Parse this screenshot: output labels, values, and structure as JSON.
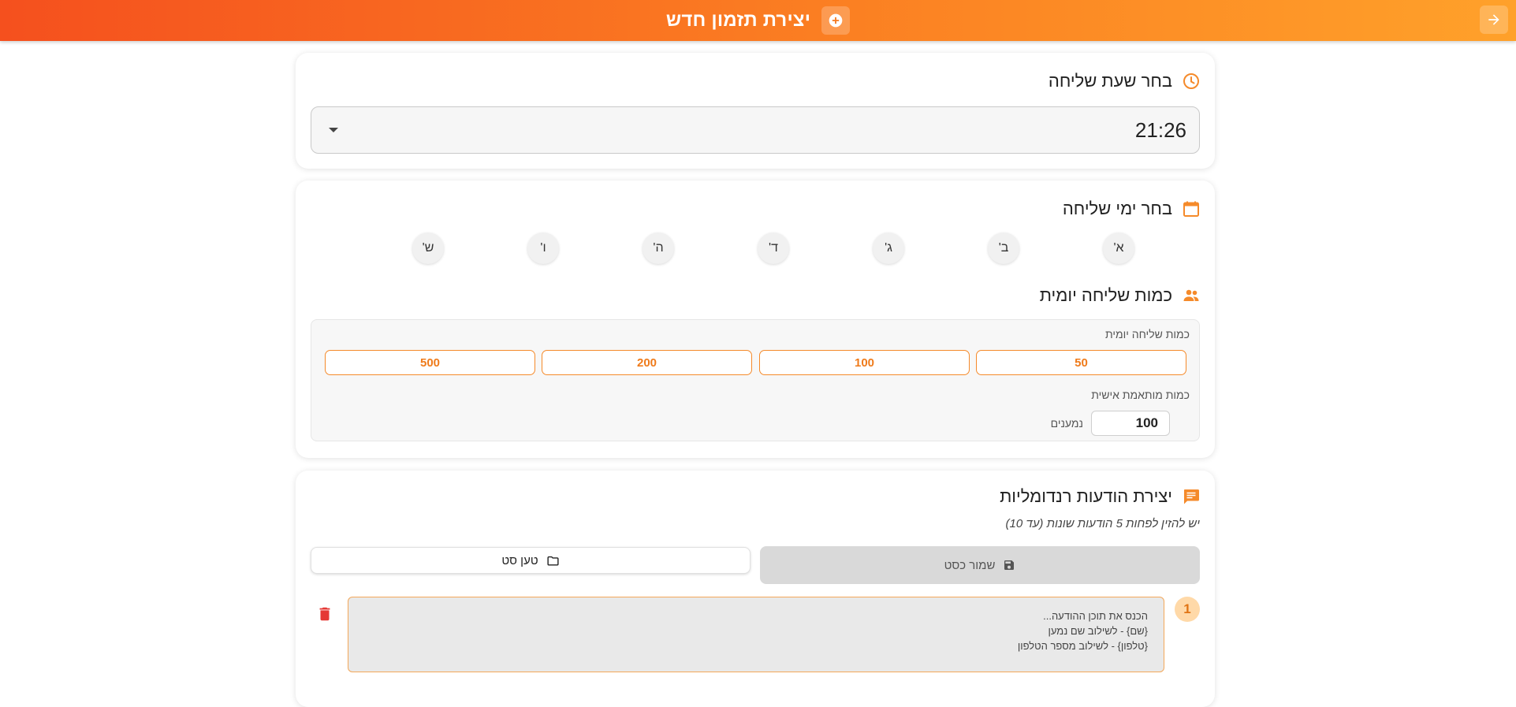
{
  "header": {
    "title": "יצירת תזמון חדש",
    "back_icon": "arrow-forward-icon",
    "title_icon": "add-circle-icon"
  },
  "time_section": {
    "title": "בחר שעת שליחה",
    "icon": "clock-icon",
    "selected_time": "21:26"
  },
  "days_section": {
    "title": "בחר ימי שליחה",
    "icon": "calendar-icon",
    "days": [
      "א'",
      "ב'",
      "ג'",
      "ד'",
      "ה'",
      "ו'",
      "ש'"
    ]
  },
  "quantity_section": {
    "title": "כמות שליחה יומית",
    "icon": "group-icon",
    "presets_label": "כמות שליחה יומית",
    "presets": [
      "50",
      "100",
      "200",
      "500"
    ],
    "custom_label": "כמות מותאמת אישית",
    "custom_value": "100",
    "unit": "נמענים"
  },
  "messages_section": {
    "title": "יצירת הודעות רנדומליות",
    "icon": "chat-icon",
    "hint": "יש להזין לפחות 5 הודעות שונות (עד 10)",
    "save_label": "שמור כסט",
    "load_label": "טען סט",
    "messages": [
      {
        "number": "1",
        "placeholder": "הכנס את תוכן ההודעה...\n{שם} - לשילוב שם נמען\n{טלפון} - לשילוב מספר הטלפון"
      }
    ]
  },
  "colors": {
    "accent": "#f58a2a",
    "header_start": "#f5501e",
    "header_end": "#ffa12a",
    "delete": "#e53935"
  }
}
